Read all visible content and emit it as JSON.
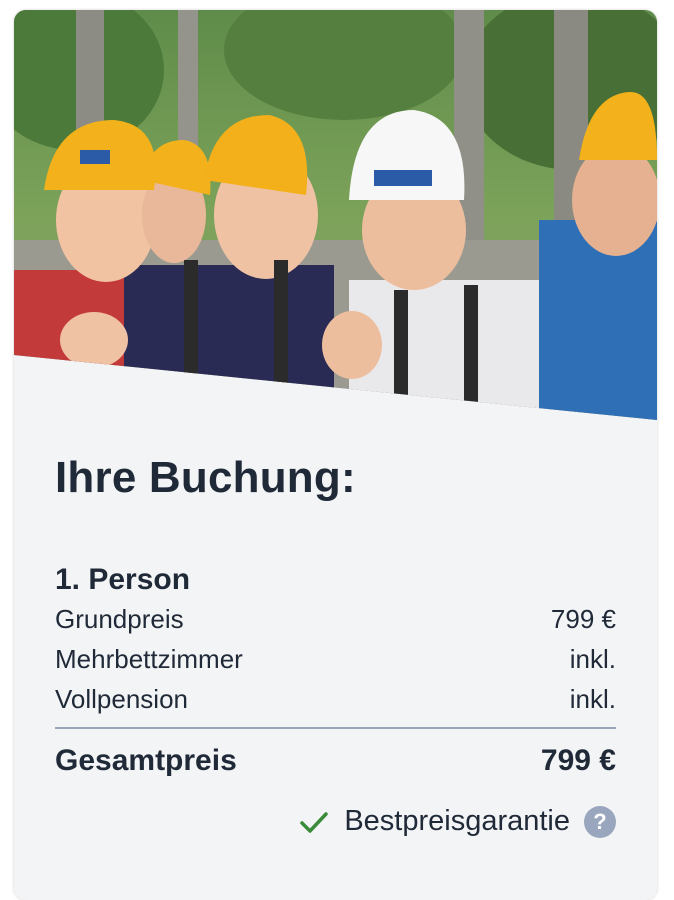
{
  "hero": {
    "icon": "photo-kids-climbing-helmets"
  },
  "booking": {
    "title": "Ihre Buchung:",
    "person_heading": "1. Person",
    "items": [
      {
        "label": "Grundpreis",
        "value": "799 €"
      },
      {
        "label": "Mehrbettzimmer",
        "value": "inkl."
      },
      {
        "label": "Vollpension",
        "value": "inkl."
      }
    ],
    "total_label": "Gesamtpreis",
    "total_value": "799 €"
  },
  "guarantee": {
    "label": "Bestpreisgarantie",
    "help_symbol": "?",
    "check_color": "#3a8b3a",
    "help_color": "#9aa6bd"
  },
  "colors": {
    "card_bg": "#f3f4f6",
    "text": "#1f2937",
    "divider": "#9aa6b8"
  }
}
